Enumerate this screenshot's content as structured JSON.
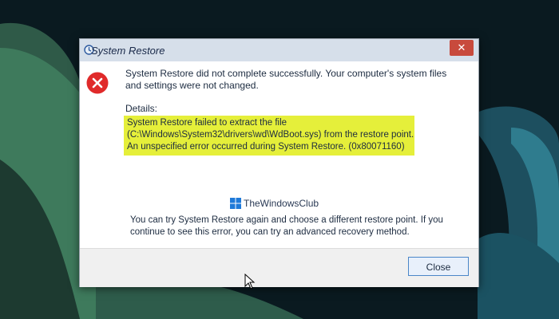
{
  "window": {
    "title": "System Restore",
    "close_glyph": "✕",
    "title_icon": "system-restore-icon"
  },
  "dialog": {
    "icon": "error-icon",
    "message": "System Restore did not complete successfully. Your computer's system files and settings were not changed.",
    "details_label": "Details:",
    "details_lines": [
      "System Restore failed to extract the file",
      "(C:\\Windows\\System32\\drivers\\wd\\WdBoot.sys) from the restore point.",
      "An unspecified error occurred during System Restore. (0x80071160)"
    ],
    "highlight_color": "#e5ef3a",
    "advice": "You can try System Restore again and choose a different restore point. If you continue to see this error, you can try an advanced recovery method."
  },
  "watermark": {
    "text": "TheWindowsClub",
    "icon": "windows-logo-icon"
  },
  "footer": {
    "close_label": "Close"
  },
  "colors": {
    "error_red": "#e02a2a",
    "button_border": "#4a86c8"
  }
}
